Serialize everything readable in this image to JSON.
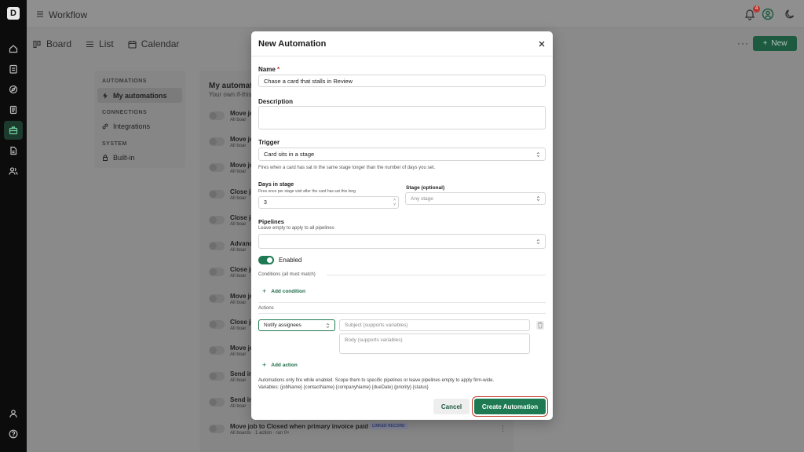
{
  "app": {
    "title": "Workflow",
    "notification_count": "4"
  },
  "view_tabs": [
    {
      "label": "Board"
    },
    {
      "label": "List"
    },
    {
      "label": "Calendar"
    }
  ],
  "toolbar": {
    "new_label": "New"
  },
  "subnav": {
    "automations_heading": "AUTOMATIONS",
    "my_automations": "My automations",
    "connections_heading": "CONNECTIONS",
    "integrations": "Integrations",
    "system_heading": "SYSTEM",
    "builtin": "Built-in"
  },
  "list": {
    "title": "My automat",
    "subtitle": "Your own if-this",
    "rows": [
      {
        "name": "Move jo",
        "meta": "All boar"
      },
      {
        "name": "Move jo",
        "meta": "All boar"
      },
      {
        "name": "Move jo",
        "meta": "All boar"
      },
      {
        "name": "Close jo",
        "meta": "All boar"
      },
      {
        "name": "Close jo",
        "meta": "All boar"
      },
      {
        "name": "Advanc",
        "meta": "All boar"
      },
      {
        "name": "Close jo",
        "meta": "All boar"
      },
      {
        "name": "Move jo",
        "meta": "All boar"
      },
      {
        "name": "Close jo",
        "meta": "All boar"
      },
      {
        "name": "Move jo",
        "meta": "All boar"
      },
      {
        "name": "Send in",
        "meta": "All boar"
      },
      {
        "name": "Send in",
        "meta": "All boar"
      },
      {
        "name": "Move job to Closed when primary invoice paid",
        "meta": "All boards · 1 action · ran 0×",
        "tag": "LINKED RECORD"
      }
    ]
  },
  "modal": {
    "title": "New Automation",
    "name_label": "Name",
    "name_required": "*",
    "name_value": "Chase a card that stalls in Review",
    "description_label": "Description",
    "description_value": "",
    "trigger_label": "Trigger",
    "trigger_value": "Card sits in a stage",
    "trigger_hint": "Fires when a card has sat in the same stage longer than the number of days you set.",
    "days_label": "Days in stage",
    "days_hint": "Fires once per stage visit after the card has sat this long",
    "days_value": "3",
    "stage_label": "Stage (optional)",
    "stage_placeholder": "Any stage",
    "pipelines_label": "Pipelines",
    "pipelines_hint": "Leave empty to apply to all pipelines",
    "pipelines_value": "",
    "enabled_label": "Enabled",
    "enabled": true,
    "conditions_label": "Conditions (all must match)",
    "add_condition": "Add condition",
    "actions_label": "Actions",
    "action_type": "Notify assignees",
    "subject_placeholder": "Subject (supports variables)",
    "body_placeholder": "Body (supports variables)",
    "add_action": "Add action",
    "footnote_1": "Automations only fire while enabled. Scope them to specific pipelines or leave pipelines empty to apply firm-wide.",
    "footnote_2": "Variables: {jobName} {contactName} {companyName} {dueDate} {priority} {status}",
    "cancel_label": "Cancel",
    "create_label": "Create Automation"
  },
  "colors": {
    "accent": "#1d7a52",
    "danger": "#c0392b",
    "rail": "#0c0c0c"
  }
}
